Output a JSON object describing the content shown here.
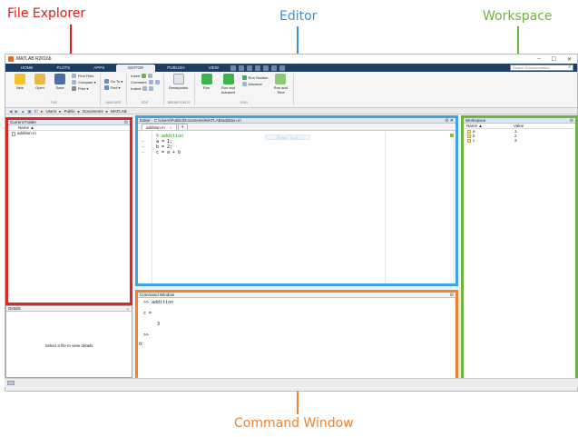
{
  "annotations": {
    "file_explorer": "File Explorer",
    "editor": "Editor",
    "workspace": "Workspace",
    "command_window": "Command Window"
  },
  "window": {
    "title": "MATLAB R2016b",
    "min": "–",
    "max": "☐",
    "close": "✕"
  },
  "tabs": [
    "HOME",
    "PLOTS",
    "APPS",
    "EDITOR",
    "PUBLISH",
    "VIEW"
  ],
  "active_tab": "EDITOR",
  "search": {
    "placeholder": "Search Documentation",
    "icon": "search-icon"
  },
  "ribbon": {
    "file": {
      "label": "FILE",
      "new": "New",
      "open": "Open",
      "save": "Save",
      "find_files": "Find Files",
      "compare": "Compare ▾",
      "print": "Print ▾"
    },
    "navigate": {
      "label": "NAVIGATE",
      "goto": "Go To ▾",
      "find": "Find ▾"
    },
    "edit": {
      "label": "EDIT",
      "insert": "Insert",
      "comment": "Comment",
      "indent": "Indent"
    },
    "breakpoints": {
      "label": "BREAKPOINTS",
      "breakpoints": "Breakpoints"
    },
    "run": {
      "label": "RUN",
      "run": "Run",
      "run_advance": "Run and Advance",
      "run_section": "Run Section",
      "advance": "Advance",
      "run_time": "Run and Time"
    }
  },
  "path": {
    "segments": [
      "C:",
      "Users",
      "Public",
      "Documents",
      "MATLAB"
    ]
  },
  "current_folder": {
    "title": "Current Folder",
    "col_name": "Name ▲",
    "files": [
      "addition.m"
    ]
  },
  "details": {
    "title": "Details",
    "message": "Select a file to view details"
  },
  "editor": {
    "title": "Editor - C:\\Users\\Public\\Documents\\MATLAB\\addition.m",
    "tab": "addition.m",
    "tab_close": "×",
    "tab_add": "+",
    "lines": [
      {
        "dash": "",
        "text": "% addition"
      },
      {
        "dash": "–",
        "text": "a = 1;"
      },
      {
        "dash": "–",
        "text": "b = 2;"
      },
      {
        "dash": "–",
        "text": "c = a + b"
      }
    ],
    "hint": "Shows tips"
  },
  "workspace": {
    "title": "Workspace",
    "col_name": "Name ▲",
    "col_value": "Value",
    "vars": [
      {
        "name": "a",
        "value": "1"
      },
      {
        "name": "b",
        "value": "2"
      },
      {
        "name": "c",
        "value": "3"
      }
    ]
  },
  "command": {
    "title": "Command Window",
    "lines": [
      ">> addition",
      "",
      "c =",
      "",
      "     3",
      "",
      ">>"
    ],
    "fx": "fx"
  }
}
